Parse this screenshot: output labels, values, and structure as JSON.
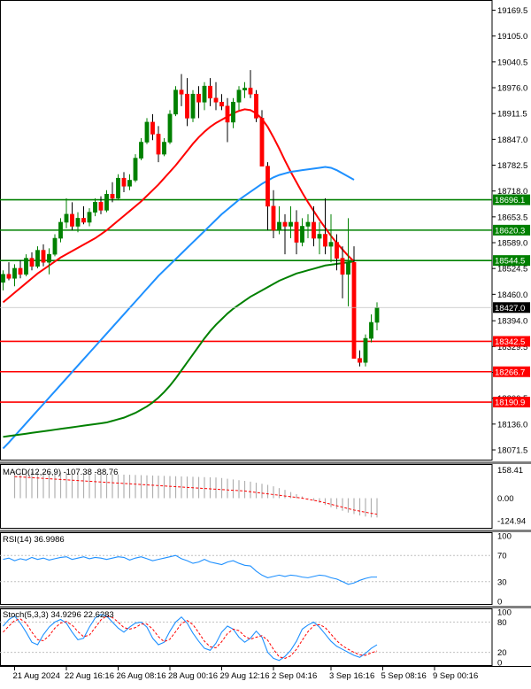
{
  "chart_data": {
    "type": "candlestick",
    "price_axis": {
      "ylim": [
        18045,
        19195
      ],
      "ticks": [
        "19169.5",
        "19105.0",
        "19040.5",
        "18976.0",
        "18911.5",
        "18847.0",
        "18782.5",
        "18718.0",
        "18653.5",
        "18589.0",
        "18524.5",
        "18460.0",
        "18394.0",
        "18329.5",
        "18265.0",
        "18200.5",
        "18136.0",
        "18071.5"
      ]
    },
    "current_price": {
      "value": 18427.0,
      "label": "18427.0"
    },
    "x_axis": {
      "ticks": [
        {
          "label": "21 Aug 2024",
          "index": 2
        },
        {
          "label": "22 Aug 16:16",
          "index": 11
        },
        {
          "label": "26 Aug 08:16",
          "index": 20
        },
        {
          "label": "28 Aug 00:16",
          "index": 29
        },
        {
          "label": "29 Aug 12:16",
          "index": 38
        },
        {
          "label": "2 Sep 04:16",
          "index": 47
        },
        {
          "label": "3 Sep 16:16",
          "index": 57
        },
        {
          "label": "5 Sep 08:16",
          "index": 66
        },
        {
          "label": "9 Sep 00:16",
          "index": 75
        }
      ]
    },
    "horizontal_levels": [
      {
        "value": 18696.1,
        "label": "18696.1",
        "color": "#008000"
      },
      {
        "value": 18620.3,
        "label": "18620.3",
        "color": "#008000"
      },
      {
        "value": 18544.5,
        "label": "18544.5",
        "color": "#008000"
      },
      {
        "value": 18342.5,
        "label": "18342.5",
        "color": "#ff0000"
      },
      {
        "value": 18266.7,
        "label": "18266.7",
        "color": "#ff0000"
      },
      {
        "value": 18190.9,
        "label": "18190.9",
        "color": "#ff0000"
      }
    ],
    "candles": [
      [
        18490,
        18520,
        18470,
        18510
      ],
      [
        18510,
        18540,
        18495,
        18500
      ],
      [
        18500,
        18535,
        18480,
        18525
      ],
      [
        18525,
        18545,
        18500,
        18510
      ],
      [
        18510,
        18560,
        18505,
        18550
      ],
      [
        18550,
        18565,
        18520,
        18530
      ],
      [
        18530,
        18580,
        18525,
        18570
      ],
      [
        18570,
        18585,
        18530,
        18540
      ],
      [
        18540,
        18575,
        18510,
        18560
      ],
      [
        18560,
        18610,
        18555,
        18600
      ],
      [
        18600,
        18650,
        18590,
        18640
      ],
      [
        18640,
        18700,
        18625,
        18660
      ],
      [
        18660,
        18690,
        18620,
        18630
      ],
      [
        18630,
        18665,
        18615,
        18650
      ],
      [
        18650,
        18680,
        18635,
        18640
      ],
      [
        18640,
        18675,
        18630,
        18665
      ],
      [
        18665,
        18700,
        18655,
        18690
      ],
      [
        18690,
        18705,
        18660,
        18670
      ],
      [
        18670,
        18720,
        18665,
        18710
      ],
      [
        18710,
        18740,
        18690,
        18700
      ],
      [
        18700,
        18760,
        18695,
        18750
      ],
      [
        18750,
        18765,
        18715,
        18730
      ],
      [
        18730,
        18760,
        18720,
        18745
      ],
      [
        18745,
        18810,
        18740,
        18800
      ],
      [
        18800,
        18850,
        18795,
        18840
      ],
      [
        18840,
        18900,
        18835,
        18890
      ],
      [
        18890,
        18910,
        18845,
        18860
      ],
      [
        18860,
        18880,
        18790,
        18810
      ],
      [
        18810,
        18850,
        18805,
        18840
      ],
      [
        18840,
        18920,
        18835,
        18910
      ],
      [
        18910,
        18980,
        18905,
        18970
      ],
      [
        18970,
        19010,
        18930,
        18960
      ],
      [
        18960,
        19000,
        18880,
        18900
      ],
      [
        18900,
        18970,
        18890,
        18960
      ],
      [
        18960,
        18980,
        18900,
        18940
      ],
      [
        18940,
        18990,
        18920,
        18980
      ],
      [
        18980,
        19000,
        18930,
        18950
      ],
      [
        18950,
        18990,
        18920,
        18940
      ],
      [
        18940,
        18960,
        18920,
        18930
      ],
      [
        18930,
        18950,
        18840,
        18890
      ],
      [
        18890,
        18950,
        18875,
        18940
      ],
      [
        18940,
        18980,
        18920,
        18970
      ],
      [
        18970,
        18990,
        18950,
        18975
      ],
      [
        18975,
        19020,
        18950,
        18960
      ],
      [
        18960,
        18970,
        18890,
        18900
      ],
      [
        18900,
        18920,
        18810,
        18780
      ],
      [
        18780,
        18790,
        18620,
        18680
      ],
      [
        18680,
        18720,
        18600,
        18620
      ],
      [
        18620,
        18680,
        18610,
        18640
      ],
      [
        18640,
        18660,
        18560,
        18630
      ],
      [
        18630,
        18680,
        18600,
        18640
      ],
      [
        18640,
        18670,
        18560,
        18590
      ],
      [
        18590,
        18650,
        18580,
        18630
      ],
      [
        18630,
        18660,
        18600,
        18640
      ],
      [
        18640,
        18680,
        18580,
        18600
      ],
      [
        18600,
        18640,
        18560,
        18610
      ],
      [
        18610,
        18700,
        18560,
        18580
      ],
      [
        18580,
        18660,
        18540,
        18590
      ],
      [
        18590,
        18610,
        18520,
        18550
      ],
      [
        18550,
        18580,
        18450,
        18510
      ],
      [
        18510,
        18650,
        18430,
        18540
      ],
      [
        18540,
        18580,
        18300,
        18300
      ],
      [
        18300,
        18320,
        18280,
        18290
      ],
      [
        18290,
        18360,
        18280,
        18350
      ],
      [
        18350,
        18410,
        18340,
        18390
      ],
      [
        18390,
        18440,
        18370,
        18427
      ]
    ],
    "candle_index_start": 0,
    "moving_averages": [
      {
        "color": "#ff0000",
        "values": [
          18440,
          18452,
          18464,
          18476,
          18488,
          18500,
          18512,
          18522,
          18532,
          18542,
          18552,
          18560,
          18568,
          18576,
          18584,
          18592,
          18600,
          18610,
          18620,
          18632,
          18644,
          18656,
          18668,
          18680,
          18692,
          18706,
          18720,
          18734,
          18750,
          18766,
          18782,
          18800,
          18818,
          18836,
          18852,
          18866,
          18878,
          18888,
          18896,
          18904,
          18912,
          18918,
          18922,
          18920,
          18912,
          18898,
          18878,
          18852,
          18824,
          18794,
          18766,
          18740,
          18714,
          18690,
          18668,
          18646,
          18626,
          18606,
          18588,
          18572,
          18556,
          18542
        ]
      },
      {
        "color": "#1e90ff",
        "values": [
          18075,
          18090,
          18106,
          18122,
          18138,
          18154,
          18170,
          18186,
          18202,
          18218,
          18234,
          18250,
          18266,
          18282,
          18298,
          18314,
          18330,
          18346,
          18362,
          18378,
          18394,
          18410,
          18426,
          18442,
          18458,
          18474,
          18490,
          18506,
          18520,
          18534,
          18548,
          18562,
          18576,
          18590,
          18604,
          18618,
          18632,
          18646,
          18660,
          18672,
          18684,
          18696,
          18706,
          18716,
          18726,
          18736,
          18744,
          18752,
          18758,
          18762,
          18766,
          18768,
          18770,
          18772,
          18774,
          18776,
          18778,
          18776,
          18770,
          18762,
          18754,
          18746
        ]
      },
      {
        "color": "#008000",
        "values": [
          18104,
          18106,
          18108,
          18110,
          18112,
          18114,
          18116,
          18118,
          18120,
          18122,
          18124,
          18126,
          18128,
          18130,
          18132,
          18134,
          18136,
          18138,
          18140,
          18144,
          18148,
          18152,
          18158,
          18164,
          18172,
          18180,
          18190,
          18202,
          18216,
          18232,
          18250,
          18270,
          18290,
          18310,
          18330,
          18350,
          18368,
          18384,
          18398,
          18412,
          18424,
          18434,
          18444,
          18454,
          18462,
          18470,
          18478,
          18486,
          18494,
          18500,
          18506,
          18512,
          18516,
          18520,
          18524,
          18528,
          18532,
          18534,
          18536,
          18538,
          18540,
          18542
        ]
      }
    ],
    "indicators": [
      {
        "name": "MACD(12,26,9)",
        "label": "MACD(12,26,9) -107.38 -88.76",
        "axis_labels": [
          "158.41",
          "0.00",
          "-124.94"
        ],
        "histogram": [
          150,
          149,
          148,
          147,
          146,
          145,
          144,
          143,
          142,
          141,
          140,
          139,
          138,
          137,
          136,
          135,
          134,
          133,
          132,
          131,
          130,
          129,
          128,
          127,
          126,
          125,
          124,
          123,
          122,
          121,
          120,
          119,
          118,
          117,
          116,
          115,
          112,
          108,
          104,
          100,
          96,
          92,
          86,
          80,
          74,
          66,
          56,
          46,
          34,
          22,
          10,
          -2,
          -14,
          -26,
          -38,
          -50,
          -60,
          -70,
          -80,
          -88,
          -96,
          -102,
          -107,
          -107.38
        ],
        "signal": [
          120,
          118,
          116,
          114,
          112,
          110,
          108,
          106,
          104,
          102,
          100,
          98,
          96,
          94,
          92,
          90,
          88,
          86,
          84,
          82,
          80,
          78,
          76,
          74,
          72,
          70,
          68,
          66,
          64,
          62,
          60,
          58,
          56,
          54,
          52,
          50,
          48,
          46,
          44,
          42,
          40,
          36,
          32,
          28,
          24,
          20,
          16,
          12,
          8,
          4,
          0,
          -6,
          -12,
          -18,
          -26,
          -34,
          -42,
          -50,
          -58,
          -66,
          -72,
          -78,
          -84,
          -88.76
        ]
      },
      {
        "name": "RSI(14)",
        "label": "RSI(14) 36.9986",
        "axis_labels": [
          "100",
          "70",
          "30",
          "0"
        ],
        "values": [
          64,
          66,
          62,
          65,
          63,
          67,
          64,
          66,
          63,
          65,
          67,
          68,
          64,
          66,
          68,
          65,
          67,
          66,
          64,
          66,
          68,
          67,
          63,
          66,
          68,
          65,
          62,
          64,
          66,
          68,
          70,
          65,
          62,
          58,
          60,
          64,
          60,
          58,
          56,
          60,
          62,
          58,
          55,
          54,
          46,
          40,
          36,
          38,
          40,
          38,
          40,
          39,
          37,
          36,
          38,
          40,
          39,
          36,
          34,
          30,
          26,
          28,
          32,
          35,
          37,
          36.9986
        ]
      },
      {
        "name": "Stoch(5,3,3)",
        "label": "Stoch(5,3,3) 34.9296 22.6283",
        "axis_labels": [
          "100",
          "80",
          "20",
          "0"
        ],
        "k": [
          72,
          85,
          92,
          78,
          60,
          40,
          35,
          55,
          70,
          80,
          85,
          78,
          60,
          45,
          48,
          70,
          88,
          95,
          92,
          80,
          68,
          60,
          70,
          78,
          80,
          70,
          48,
          35,
          40,
          62,
          80,
          90,
          78,
          58,
          42,
          28,
          24,
          38,
          60,
          72,
          66,
          50,
          40,
          48,
          62,
          50,
          20,
          8,
          4,
          12,
          24,
          42,
          66,
          74,
          80,
          70,
          56,
          42,
          32,
          26,
          20,
          14,
          10,
          18,
          28,
          34.9296
        ],
        "d": [
          60,
          72,
          83,
          86,
          78,
          60,
          45,
          43,
          53,
          68,
          78,
          81,
          74,
          61,
          51,
          54,
          69,
          84,
          92,
          89,
          80,
          69,
          66,
          69,
          76,
          76,
          66,
          51,
          41,
          46,
          61,
          77,
          83,
          75,
          59,
          42,
          31,
          29,
          41,
          57,
          66,
          63,
          52,
          46,
          50,
          53,
          44,
          26,
          11,
          8,
          13,
          26,
          44,
          61,
          73,
          75,
          69,
          56,
          43,
          33,
          26,
          20,
          15,
          14,
          19,
          22.6283
        ]
      }
    ]
  }
}
